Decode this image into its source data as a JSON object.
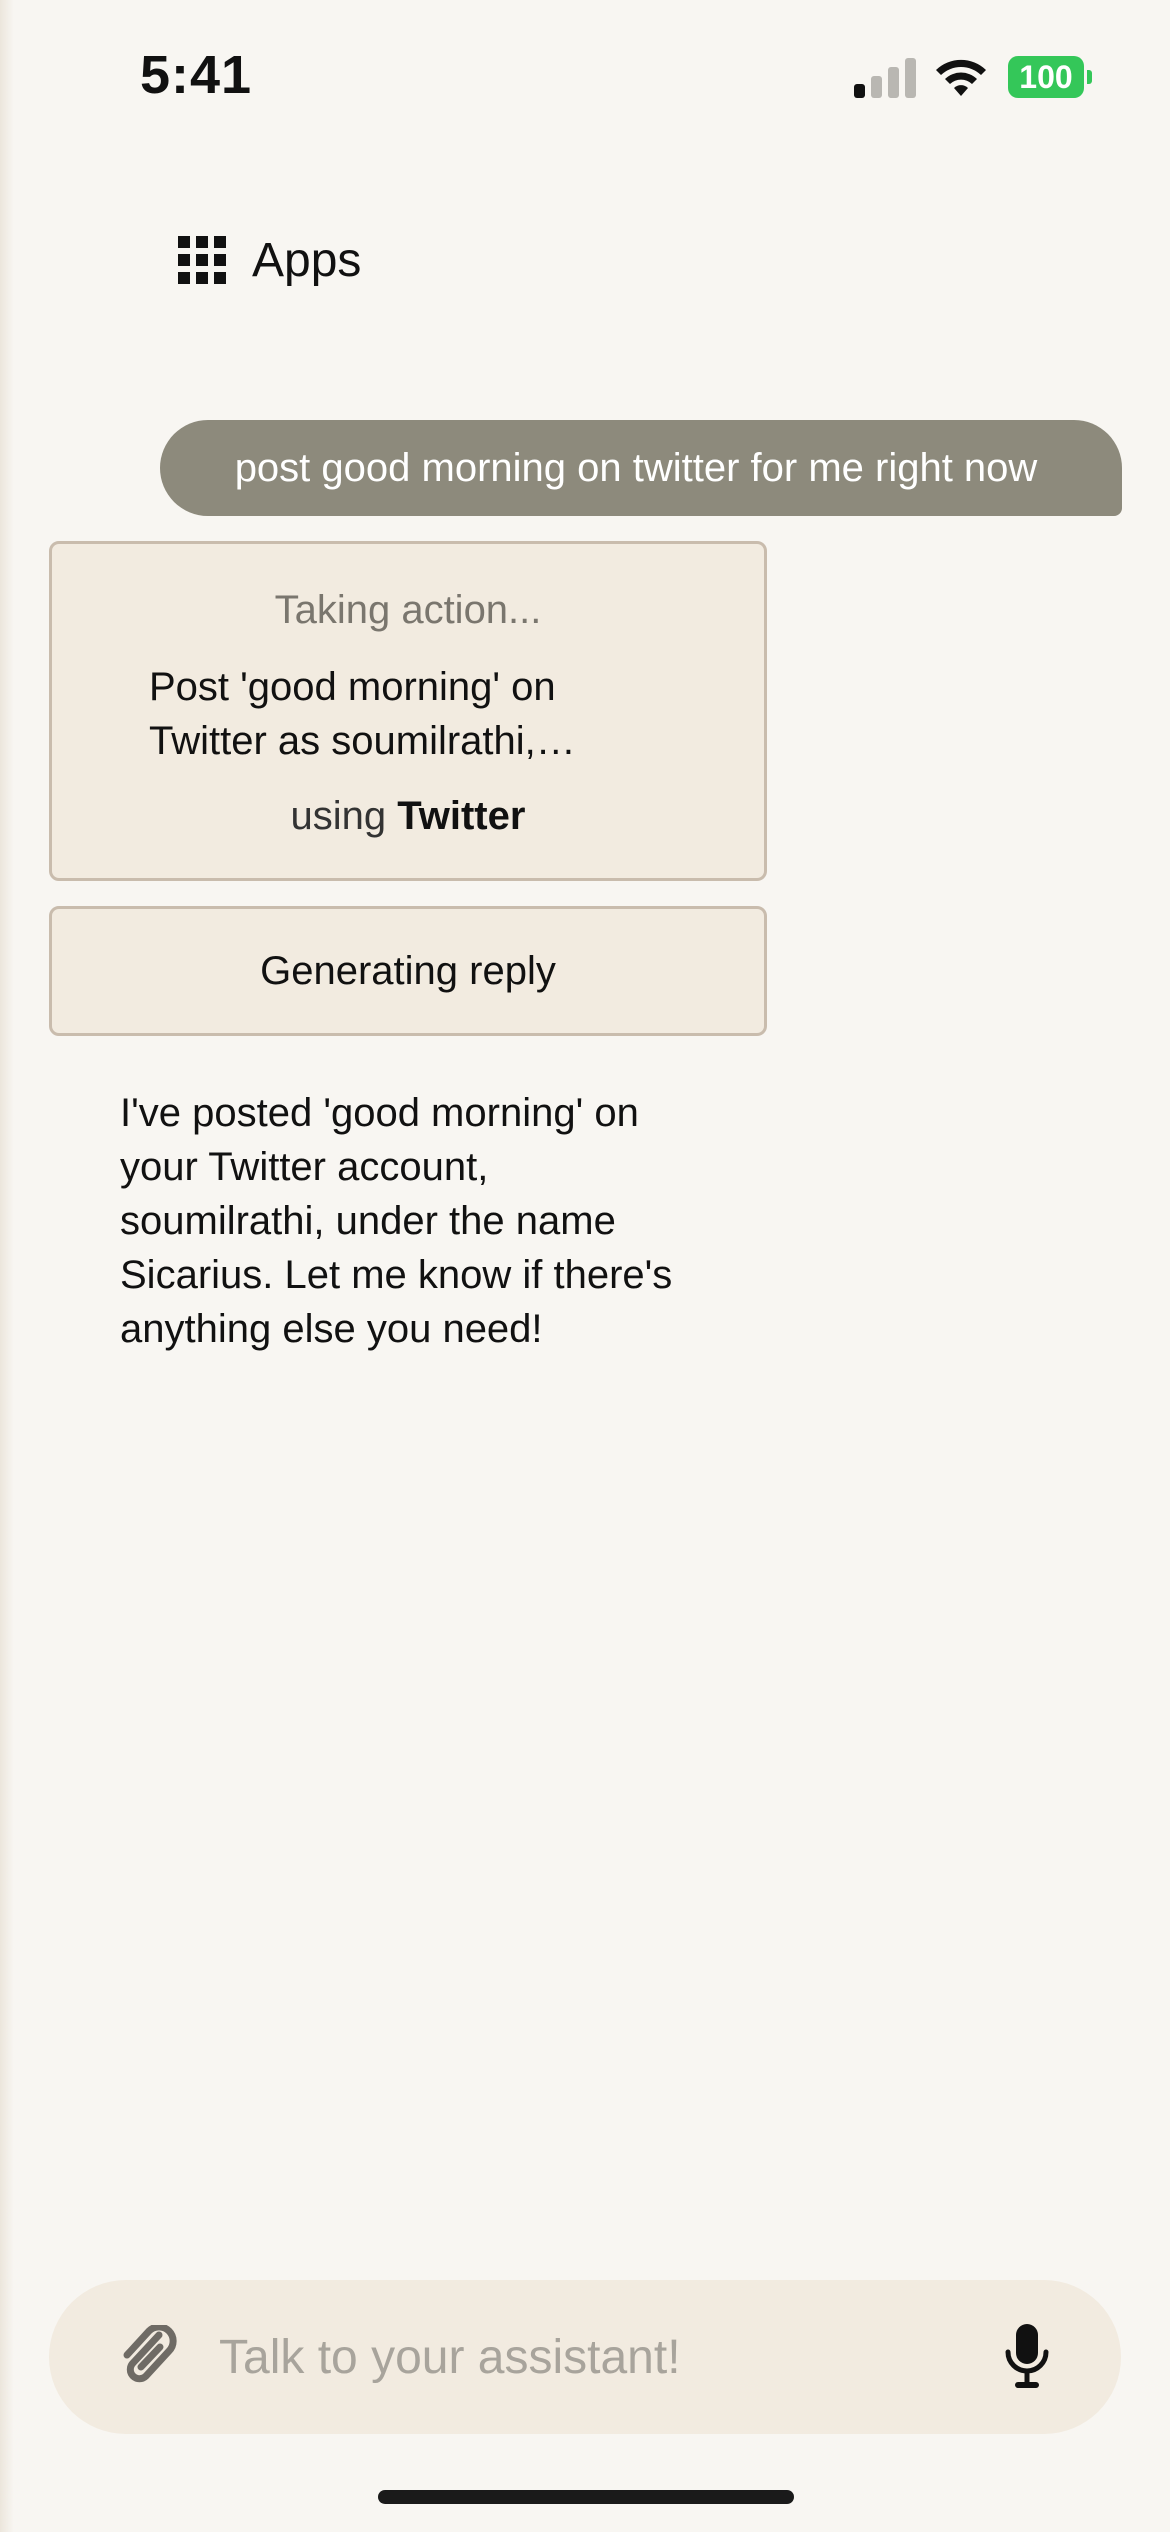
{
  "status_bar": {
    "time": "5:41",
    "battery": "100",
    "signal_icon": "cellular-signal-icon",
    "wifi_icon": "wifi-icon",
    "battery_color": "#34c759"
  },
  "header": {
    "apps_label": "Apps",
    "apps_icon": "grid-icon"
  },
  "conversation": {
    "user_message": "post good morning on twitter for me right now",
    "action": {
      "status": "Taking action...",
      "description": "Post 'good morning' on Twitter as soumilrathi,…",
      "using_prefix": "using",
      "app_name": "Twitter"
    },
    "generating_status": "Generating reply",
    "assistant_reply": "I've posted 'good morning' on your Twitter account, soumilrathi, under the name Sicarius. Let me know if there's anything else you need!"
  },
  "composer": {
    "placeholder": "Talk to your assistant!",
    "value": "",
    "attach_icon": "paperclip-icon",
    "mic_icon": "microphone-icon"
  },
  "colors": {
    "background": "#f8f6f2",
    "user_bubble": "#8d8a7c",
    "card_background": "#f2ebe0",
    "card_border": "#c9bcad"
  }
}
